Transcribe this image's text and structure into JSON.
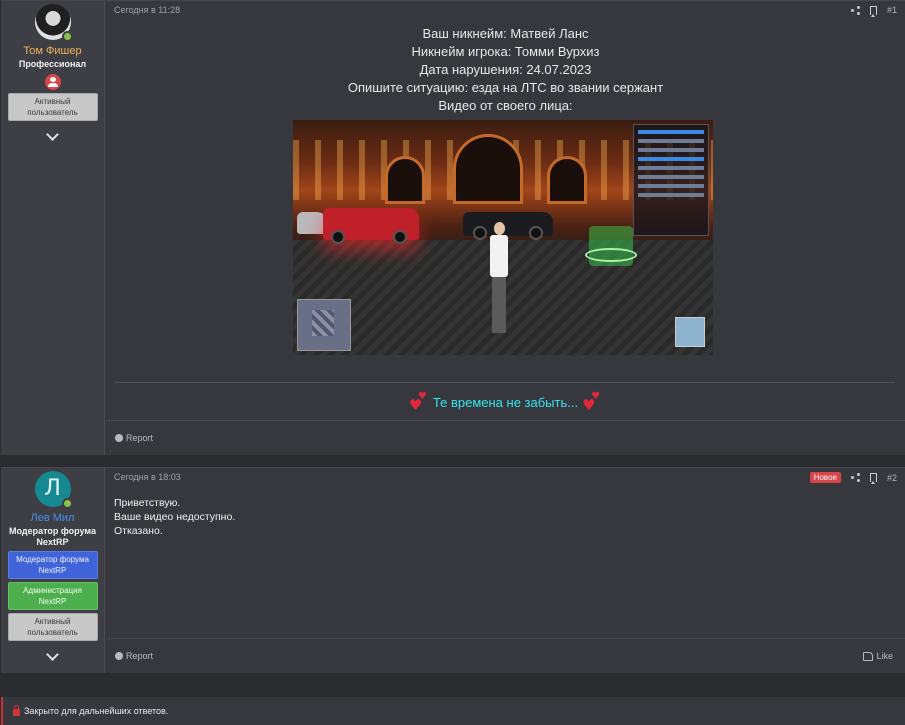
{
  "posts": [
    {
      "author": {
        "name": "Том Фишер",
        "title": "Профессионал",
        "banners": [
          "Активный пользователь"
        ]
      },
      "date": "Сегодня в 11:28",
      "number": "#1",
      "content_lines": [
        "Ваш никнейм: Матвей Ланс",
        "Никнейм игрока: Томми Вурхиз",
        "Дата нарушения: 24.07.2023",
        "Опишите ситуацию: езда на ЛТС во звании сержант",
        "Видео от своего лица:"
      ],
      "signature": "Те времена не забыть...",
      "report_label": "Report"
    },
    {
      "author": {
        "avatar_letter": "Л",
        "name": "Лев Мил",
        "title": "Модератор форума NextRP",
        "banners": [
          "Модератор форума NextRP",
          "Администрация NextRP",
          "Активный пользователь"
        ]
      },
      "date": "Сегодня в 18:03",
      "new_badge": "Новое",
      "number": "#2",
      "content_lines": [
        "Приветствую.",
        "Ваше видео недоступно.",
        "Отказано."
      ],
      "report_label": "Report",
      "like_label": "Like"
    }
  ],
  "closed_notice": "Закрыто для дальнейших ответов.",
  "colors": {
    "page_bg": "#2a2c30",
    "post_bg": "#36383d",
    "signature": "#35e6ef",
    "new_badge": "#d94448",
    "banner_blue": "#3f63d8",
    "banner_green": "#4cae4c"
  },
  "icons": [
    "share-icon",
    "bookmark-icon",
    "report-icon",
    "like-icon",
    "lock-icon",
    "chevron-down-icon",
    "hearts-icon"
  ]
}
